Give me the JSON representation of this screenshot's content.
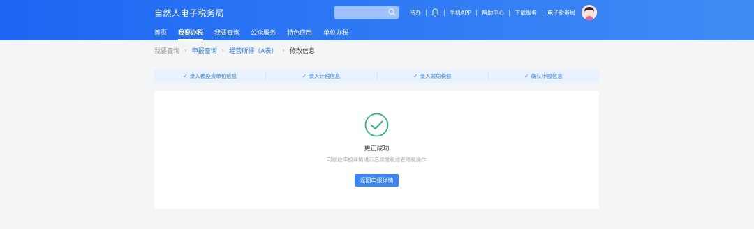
{
  "header": {
    "brand": "自然人电子税务局",
    "search": {
      "placeholder": ""
    },
    "links": {
      "todo": "待办",
      "mobile_app": "手机APP",
      "help_center": "帮助中心",
      "download_service": "下载服务",
      "e_tax_bureau": "电子税务局"
    }
  },
  "nav": {
    "tabs": [
      {
        "label": "首页"
      },
      {
        "label": "我要办税",
        "active": true
      },
      {
        "label": "我要查询"
      },
      {
        "label": "公众服务"
      },
      {
        "label": "特色应用"
      },
      {
        "label": "单位办税"
      }
    ]
  },
  "breadcrumb": [
    "我要查询",
    "申报查询",
    "经营所得（A表）",
    "修改信息"
  ],
  "steps": [
    {
      "label": "录入被投资单位信息"
    },
    {
      "label": "录入计税信息"
    },
    {
      "label": "录入减免税额"
    },
    {
      "label": "确认申报信息"
    }
  ],
  "result": {
    "title": "更正成功",
    "description": "可前往申报详情进行后续缴税或者退税操作",
    "button_label": "返回申报详情"
  },
  "colors": {
    "header_start": "#1d66f3",
    "header_end": "#3f8cf5",
    "accent": "#3b86f6",
    "success": "#2fb57c"
  }
}
